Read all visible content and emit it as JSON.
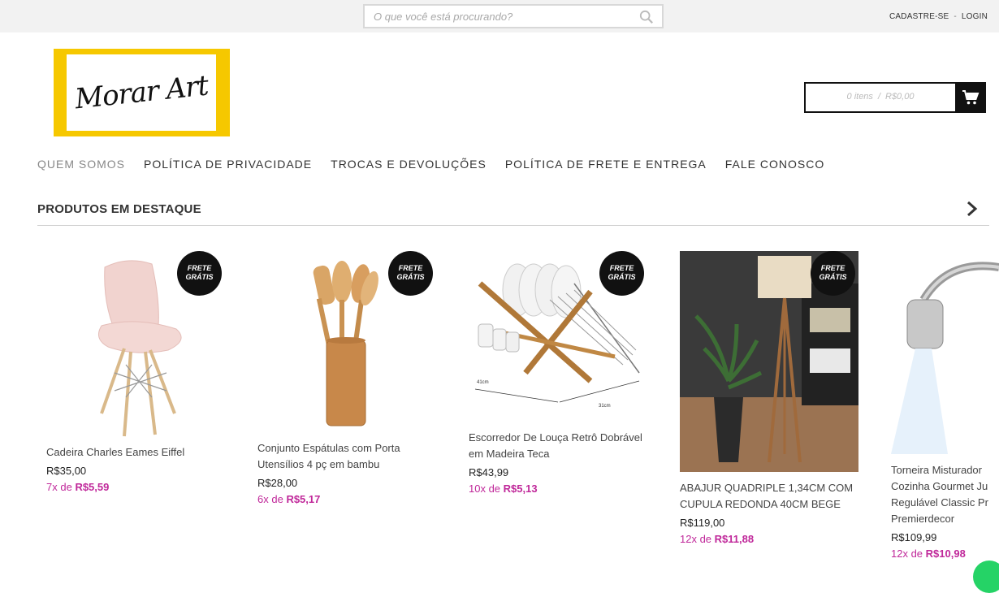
{
  "search": {
    "placeholder": "O que você está procurando?"
  },
  "account": {
    "signup": "CADASTRE-SE",
    "separator": "-",
    "login": "LOGIN"
  },
  "logo": {
    "text": "Morar Art"
  },
  "cart": {
    "items": "0 itens",
    "separator": "/",
    "total": "R$0,00",
    "icon": "shopping-cart-icon"
  },
  "nav": [
    "QUEM SOMOS",
    "POLÍTICA DE PRIVACIDADE",
    "TROCAS E DEVOLUÇÕES",
    "POLÍTICA DE FRETE E ENTREGA",
    "FALE CONOSCO"
  ],
  "section": {
    "title": "PRODUTOS EM DESTAQUE"
  },
  "badge": {
    "line1": "FRETE",
    "line2": "GRÁTIS"
  },
  "products": [
    {
      "name": "Cadeira Charles Eames Eiffel",
      "price": "R$35,00",
      "inst_prefix": "7x de",
      "inst_value": "R$5,59"
    },
    {
      "name": "Conjunto Espátulas com Porta Utensílios 4 pç em bambu",
      "price": "R$28,00",
      "inst_prefix": "6x de",
      "inst_value": "R$5,17"
    },
    {
      "name": "Escorredor De Louça Retrô Dobrável em Madeira Teca",
      "price": "R$43,99",
      "inst_prefix": "10x de",
      "inst_value": "R$5,13"
    },
    {
      "name": "ABAJUR QUADRIPLE 1,34CM COM CUPULA REDONDA 40CM BEGE",
      "price": "R$119,00",
      "inst_prefix": "12x de",
      "inst_value": "R$11,88"
    },
    {
      "name": "Torneira Misturador Cozinha Gourmet Ju Regulável Classic Pr Premierdecor",
      "price": "R$109,99",
      "inst_prefix": "12x de",
      "inst_value": "R$10,98"
    }
  ],
  "dims": {
    "rack_width": "41cm",
    "rack_depth": "31cm"
  }
}
